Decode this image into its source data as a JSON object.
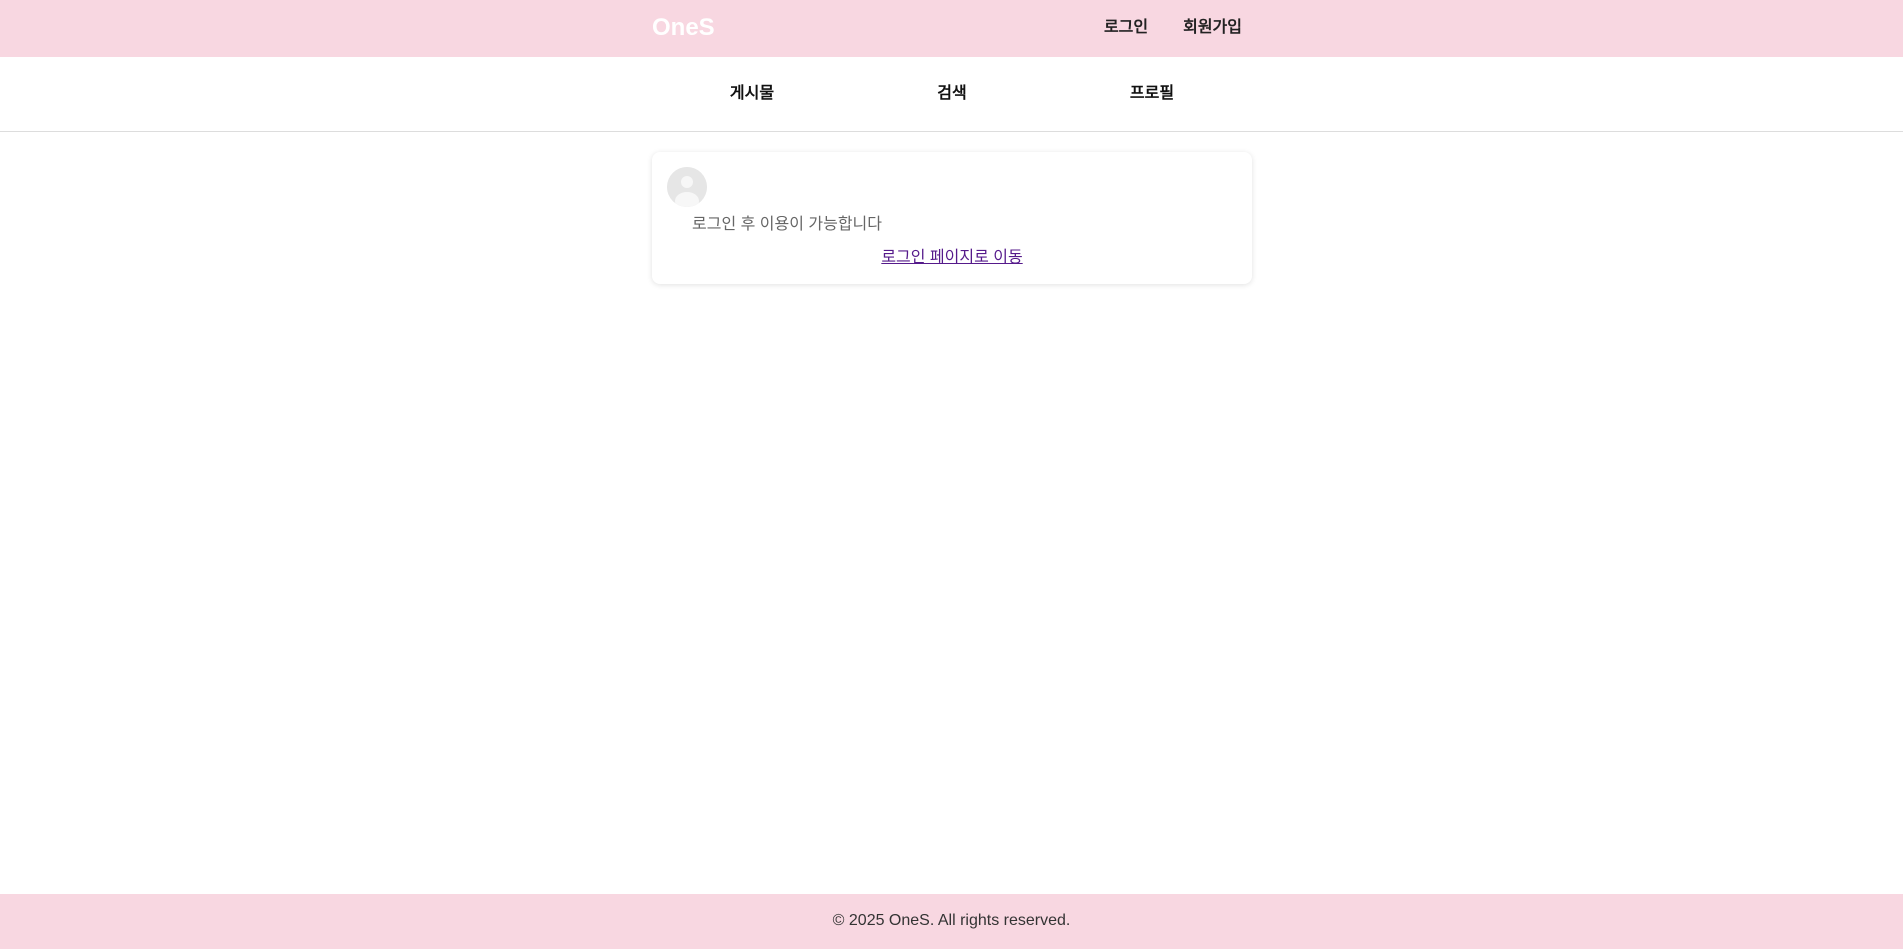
{
  "header": {
    "logo": "OneS",
    "login_label": "로그인",
    "signup_label": "회원가입"
  },
  "nav": {
    "items": [
      {
        "label": "게시물"
      },
      {
        "label": "검색"
      },
      {
        "label": "프로필"
      }
    ]
  },
  "card": {
    "avatar_icon": "user-avatar-icon",
    "message": "로그인 후 이용이 가능합니다",
    "link_label": "로그인 페이지로 이동"
  },
  "footer": {
    "text": "© 2025 OneS. All rights reserved."
  },
  "colors": {
    "brand_pink": "#f8d7e1",
    "visited_link": "#551a8b"
  }
}
